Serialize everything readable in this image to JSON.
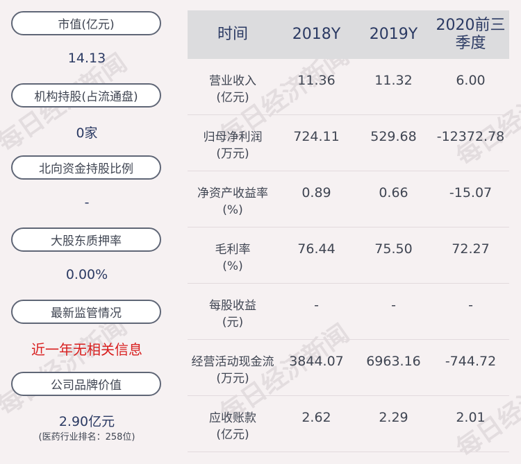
{
  "left": {
    "items": [
      {
        "label": "市值(亿元)",
        "value": "14.13"
      },
      {
        "label": "机构持股(占流通盘)",
        "value": "0家"
      },
      {
        "label": "北向资金持股比例",
        "value": "-"
      },
      {
        "label": "大股东质押率",
        "value": "0.00%"
      },
      {
        "label": "最新监管情况",
        "value": "近一年无相关信息"
      },
      {
        "label": "公司品牌价值",
        "value": "2.90亿元",
        "sub": "(医药行业排名：258位)"
      }
    ]
  },
  "table": {
    "headers": [
      "时间",
      "2018Y",
      "2019Y",
      "2020前三季度"
    ],
    "rows": [
      {
        "name": [
          "营业收入",
          "(亿元)"
        ],
        "values": [
          "11.36",
          "11.32",
          "6.00"
        ]
      },
      {
        "name": [
          "归母净利润",
          "(万元)"
        ],
        "values": [
          "724.11",
          "529.68",
          "-12372.78"
        ]
      },
      {
        "name": [
          "净资产收益率",
          "(%)"
        ],
        "values": [
          "0.89",
          "0.66",
          "-15.07"
        ]
      },
      {
        "name": [
          "毛利率",
          "(%)"
        ],
        "values": [
          "76.44",
          "75.50",
          "72.27"
        ]
      },
      {
        "name": [
          "每股收益",
          "(元)"
        ],
        "values": [
          "-",
          "-",
          "-"
        ]
      },
      {
        "name": [
          "经营活动现金流",
          "(万元)"
        ],
        "values": [
          "3844.07",
          "6963.16",
          "-744.72"
        ]
      },
      {
        "name": [
          "应收账款",
          "(亿元)"
        ],
        "values": [
          "2.62",
          "2.29",
          "2.01"
        ]
      }
    ]
  },
  "watermark": "每日经济新闻"
}
